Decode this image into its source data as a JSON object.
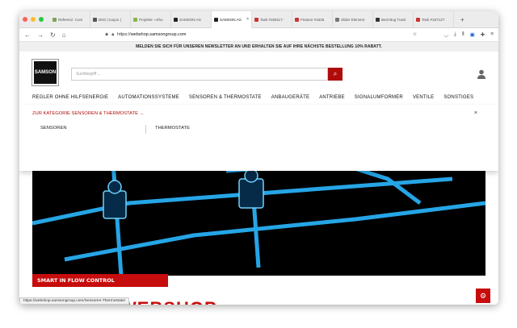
{
  "browser": {
    "tabs": [
      {
        "label": "Referenz: Com",
        "color": "#7ea35c"
      },
      {
        "label": "DKD | toujou |",
        "color": "#555555"
      },
      {
        "label": "Projekte: «Sho",
        "color": "#8bb54a"
      },
      {
        "label": "SAMSON AG",
        "color": "#222222"
      },
      {
        "label": "SAMSON AG",
        "color": "#222222",
        "active": true
      },
      {
        "label": "Task #158117:",
        "color": "#cc3333"
      },
      {
        "label": "Feature #1535",
        "color": "#cc3333"
      },
      {
        "label": "Slider Element",
        "color": "#777777"
      },
      {
        "label": "Best Bug Track",
        "color": "#333333"
      },
      {
        "label": "Task #157127:",
        "color": "#cc3333"
      }
    ],
    "new_tab": "+",
    "url_prefix": "https://",
    "url_domain": "webshop.samsongroup.com",
    "status_url": "https://webshop.samsongroup.com/Sensoren-Thermostate/"
  },
  "newsletter": "MELDEN SIE SICH FÜR UNSEREN NEWSLETTER AN UND ERHALTEN SIE AUF IHRE NÄCHSTE BESTELLUNG 10% RABATT.",
  "header": {
    "logo_text": "SAMSON",
    "search_placeholder": "Suchbegriff ..."
  },
  "nav": [
    "REGLER OHNE HILFSENERGIE",
    "AUTOMATIONSSYSTEME",
    "SENSOREN & THERMOSTATE",
    "ANBAUGERÄTE",
    "ANTRIEBE",
    "SIGNALUMFORMER",
    "VENTILE",
    "SONSTIGES"
  ],
  "dropdown": {
    "category_link": "ZUR KATEGORIE SENSOREN & THERMOSTATE →",
    "close": "×",
    "subcategories": [
      "SENSOREN",
      "THERMOSTATE"
    ]
  },
  "hero": {
    "band_text": "SMART IN FLOW CONTROL",
    "title": "WEBSHOP"
  },
  "colors": {
    "accent": "#c60c0c",
    "link": "#b10c0c"
  }
}
